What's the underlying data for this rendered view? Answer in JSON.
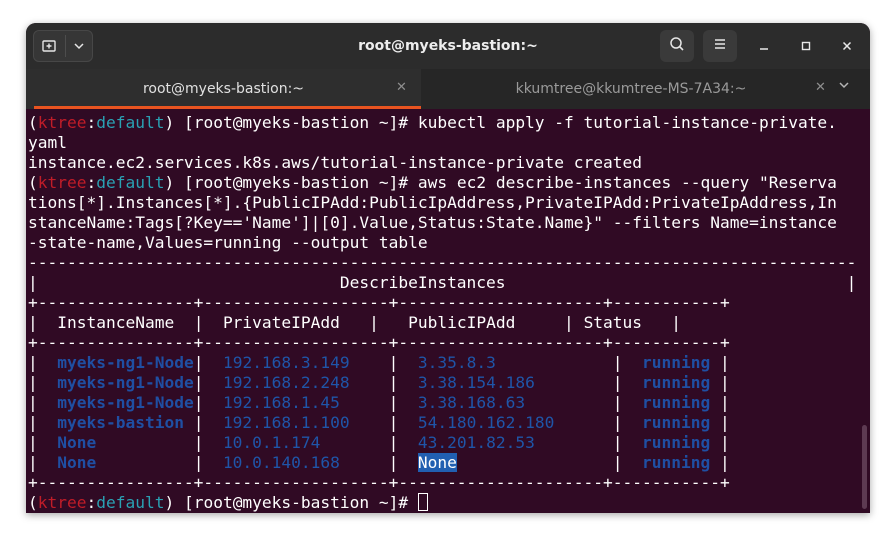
{
  "window": {
    "title": "root@myeks-bastion:~"
  },
  "tabs": [
    {
      "label": "root@myeks-bastion:~",
      "active": true
    },
    {
      "label": "kkumtree@kkumtree-MS-7A34:~",
      "active": false
    }
  ],
  "icons": {
    "new_tab": "new-tab-icon",
    "dropdown": "chevron-down-icon",
    "search": "search-icon",
    "menu": "hamburger-menu-icon",
    "minimize": "minimize-icon",
    "maximize": "maximize-icon",
    "close": "close-icon"
  },
  "colors": {
    "background": "#300a24",
    "prompt_env": "#c01c28",
    "prompt_ctx": "#2aa1b3",
    "table_text": "#1f4fa3",
    "accent": "#e95420"
  },
  "prompt": {
    "open": "(",
    "env": "ktree",
    "colon": ":",
    "ctx": "default",
    "rest": ") [root@myeks-bastion ~]# "
  },
  "commands": {
    "apply_a": "kubectl apply -f tutorial-instance-private.",
    "apply_b": "yaml",
    "apply_output": "instance.ec2.services.k8s.aws/tutorial-instance-private created",
    "describe_a": "aws ec2 describe-instances --query \"Reserva",
    "describe_b": "tions[*].Instances[*].{PublicIPAdd:PublicIpAddress,PrivateIPAdd:PrivateIpAddress,In",
    "describe_c": "stanceName:Tags[?Key=='Name']|[0].Value,Status:State.Name}\" --filters Name=instance",
    "describe_d": "-state-name,Values=running --output table"
  },
  "table": {
    "top_border": "-------------------------------------------------------------------------------------",
    "title_row": "|                               DescribeInstances                                   |",
    "border": "+----------------+-------------------+---------------------+-----------+",
    "headers": {
      "instance_name": "InstanceName",
      "private_ip": "PrivateIPAdd",
      "public_ip": "PublicIPAdd",
      "status": "Status"
    },
    "rows": [
      {
        "instance_name": "myeks-ng1-Node",
        "private_ip": "192.168.3.149",
        "public_ip": "3.35.8.3",
        "status": "running"
      },
      {
        "instance_name": "myeks-ng1-Node",
        "private_ip": "192.168.2.248",
        "public_ip": "3.38.154.186",
        "status": "running"
      },
      {
        "instance_name": "myeks-ng1-Node",
        "private_ip": "192.168.1.45",
        "public_ip": "3.38.168.63",
        "status": "running"
      },
      {
        "instance_name": "myeks-bastion",
        "private_ip": "192.168.1.100",
        "public_ip": "54.180.162.180",
        "status": "running"
      },
      {
        "instance_name": "None",
        "private_ip": "10.0.1.174",
        "public_ip": "43.201.82.53",
        "status": "running"
      },
      {
        "instance_name": "None",
        "private_ip": "10.0.140.168",
        "public_ip": "None",
        "status": "running"
      }
    ]
  }
}
